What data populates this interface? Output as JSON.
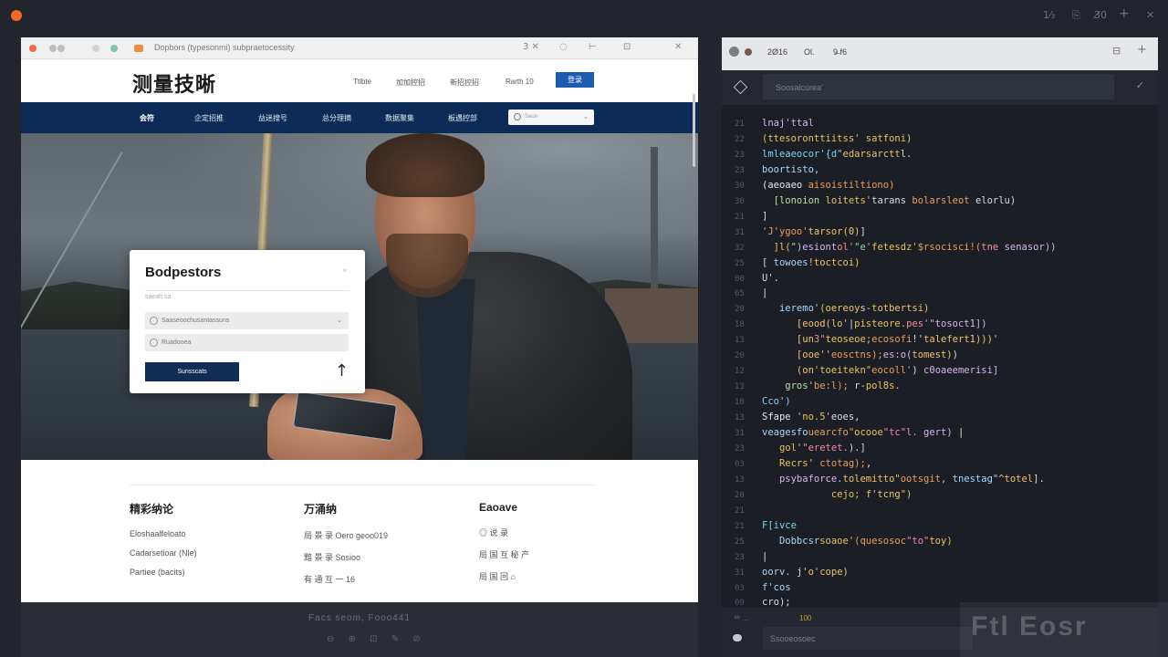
{
  "desktop": {
    "controls": [
      "1⁄₃",
      "⎘",
      "3̸0",
      "+",
      "✕"
    ],
    "dim_glyph": "◦"
  },
  "browser": {
    "tab_title": "Dopbors (typesonmi) subpraetocessity",
    "chrome_icons": [
      "3 ✕",
      "◌",
      "⊢",
      "⊡",
      "✕"
    ],
    "site": {
      "logo": "测量技晰",
      "nav": [
        "Ttlbte",
        "加加控招",
        "新招控招",
        "Rarth 10"
      ],
      "cta": "登录",
      "blue_nav": [
        "会符",
        "企定招推",
        "益迷搜号",
        "总分理摘",
        "数据聚集",
        "板遇控部"
      ],
      "search_placeholder": "Saun",
      "search_chevron": "⌄"
    },
    "login": {
      "title": "Bodpestors",
      "close": "×",
      "subtitle": "saeah sa",
      "field1": "Saaseoochusantassuns",
      "field1_chevron": "⌄",
      "field2": "Ruadooea",
      "button": "Sunsscats",
      "arrow": "↑"
    },
    "footer": {
      "columns": [
        {
          "heading": "精彩纳论",
          "items": [
            "Eloshaalfeloato",
            "Cadarsetioar (Nle)",
            "Partiee  (bacits)"
          ]
        },
        {
          "heading": "万涌纳",
          "items": [
            "局 景 录   Oero  geoo019",
            "黯 景 录   Sosioo",
            "有 通 互   一 16"
          ]
        },
        {
          "heading": "Eaoave",
          "items": [
            "◎ 说 录",
            "局 国 互 秘 产",
            "局 国 回 ⌂"
          ]
        }
      ]
    },
    "taskbar_text": "Facs  seom,  Fooo441",
    "taskbar_icons": [
      "⊖",
      "⊕",
      "⊡",
      "✎",
      "⊘"
    ]
  },
  "editor": {
    "tabs": [
      "2Ø16",
      "Ol.",
      "9̶ f6"
    ],
    "header_icons": [
      "⊟",
      "+"
    ],
    "search_placeholder": "Soosalcu̇rea'",
    "confirm_icon": "✓",
    "lines": [
      {
        "n": "21",
        "segs": [
          {
            "t": "lnaj'ttal",
            "c": "#d8b6f2"
          }
        ]
      },
      {
        "n": "22",
        "segs": [
          {
            "t": "(ttesoronttiitss' ",
            "c": "#e8c45c"
          },
          {
            "t": "satfoni)",
            "c": "#e8c45c"
          }
        ]
      },
      {
        "n": "23",
        "segs": [
          {
            "t": "lmleaeocor'{d\"",
            "c": "#7ed3f7"
          },
          {
            "t": "edarsarctt",
            "c": "#eac071"
          },
          {
            "t": "l.",
            "c": "#ddd"
          }
        ]
      },
      {
        "n": "23",
        "segs": [
          {
            "t": "boortisto,",
            "c": "#a7d8ff"
          }
        ]
      },
      {
        "n": "30",
        "segs": [
          {
            "t": "(aeoaeo ",
            "c": "#e8e8e8"
          },
          {
            "t": "aisoistiltiono)",
            "c": "#ed9f5c"
          }
        ]
      },
      {
        "n": "30",
        "segs": [
          {
            "t": "  [lonoion ",
            "c": "#b6e3a2"
          },
          {
            "t": "loitets'",
            "c": "#e8c45c"
          },
          {
            "t": "tarans ",
            "c": "#ddd"
          },
          {
            "t": "bolarsleot ",
            "c": "#ed9f5c"
          },
          {
            "t": "elorlu)",
            "c": "#ddd"
          }
        ]
      },
      {
        "n": "21",
        "segs": [
          {
            "t": "]",
            "c": "#ddd"
          }
        ]
      },
      {
        "n": "31",
        "segs": [
          {
            "t": "'J'ygoo'",
            "c": "#ed9f5c"
          },
          {
            "t": "tarsor(0)",
            "c": "#f0c36a"
          },
          {
            "t": "]",
            "c": "#ddd"
          }
        ]
      },
      {
        "n": "32",
        "segs": [
          {
            "t": "  ]l(\"",
            "c": "#f0c36a"
          },
          {
            "t": ")esiont",
            "c": "#d8b6f2"
          },
          {
            "t": "ol'",
            "c": "#f58ba0"
          },
          {
            "t": "\"e'",
            "c": "#8fd9a8"
          },
          {
            "t": "fetesdz'",
            "c": "#e8c45c"
          },
          {
            "t": "$rsocisci!(",
            "c": "#ed9f5c"
          },
          {
            "t": "tne ",
            "c": "#f58ba0"
          },
          {
            "t": "senasor))",
            "c": "#d8b6f2"
          }
        ]
      },
      {
        "n": "25",
        "segs": [
          {
            "t": "[ ",
            "c": "#ddd"
          },
          {
            "t": "towoes",
            "c": "#a7d8ff"
          },
          {
            "t": "!toctcoi)",
            "c": "#f0c36a"
          }
        ]
      },
      {
        "n": "00",
        "segs": [
          {
            "t": "U'.",
            "c": "#ddd"
          }
        ]
      },
      {
        "n": "65",
        "segs": [
          {
            "t": "|",
            "c": "#ddd"
          }
        ]
      },
      {
        "n": "20",
        "segs": [
          {
            "t": "   ieremo'",
            "c": "#a7d8ff"
          },
          {
            "t": "(oereoy",
            "c": "#f0c36a"
          },
          {
            "t": "s-",
            "c": "#ddd"
          },
          {
            "t": "totbertsi)",
            "c": "#f0c36a"
          }
        ]
      },
      {
        "n": "18",
        "segs": [
          {
            "t": "      [eood(lo'",
            "c": "#f0c36a"
          },
          {
            "t": "|",
            "c": "#ddd"
          },
          {
            "t": "pisteore.",
            "c": "#e8c45c"
          },
          {
            "t": "pes'",
            "c": "#f58ba0"
          },
          {
            "t": "\"tosoct1])",
            "c": "#d8b6f2"
          }
        ]
      },
      {
        "n": "13",
        "segs": [
          {
            "t": "      [un",
            "c": "#f0c36a"
          },
          {
            "t": "3\"",
            "c": "#f58ba0"
          },
          {
            "t": "teoseoe;",
            "c": "#e8c45c"
          },
          {
            "t": "ecosofi",
            "c": "#ed9f5c"
          },
          {
            "t": "!'",
            "c": "#ddd"
          },
          {
            "t": "talefert1)))'",
            "c": "#f0c36a"
          }
        ]
      },
      {
        "n": "20",
        "segs": [
          {
            "t": "      [ooe''",
            "c": "#f0c36a"
          },
          {
            "t": "eosctns);",
            "c": "#ed9f5c"
          },
          {
            "t": "es:o(",
            "c": "#d8b6f2"
          },
          {
            "t": "tomest)",
            "c": "#f0c36a"
          },
          {
            "t": ")",
            "c": "#ddd"
          }
        ]
      },
      {
        "n": "12",
        "segs": [
          {
            "t": "      (on'",
            "c": "#f0c36a"
          },
          {
            "t": "toeitekn\"",
            "c": "#e8c45c"
          },
          {
            "t": "eocoll'",
            "c": "#ed9f5c"
          },
          {
            "t": ") ",
            "c": "#ddd"
          },
          {
            "t": "c0oaeemerisi]",
            "c": "#d8b6f2"
          }
        ]
      },
      {
        "n": "13",
        "segs": [
          {
            "t": "    gros'",
            "c": "#b6e3a2"
          },
          {
            "t": "be:l);",
            "c": "#ed9f5c"
          },
          {
            "t": " r-",
            "c": "#ddd"
          },
          {
            "t": "pol8s.",
            "c": "#e8c45c"
          }
        ]
      },
      {
        "n": "10",
        "segs": [
          {
            "t": "Cco')",
            "c": "#7ed3f7"
          }
        ]
      },
      {
        "n": "13",
        "segs": [
          {
            "t": "Sfape ",
            "c": "#e8e8e8"
          },
          {
            "t": "'no.5'",
            "c": "#e8c45c"
          },
          {
            "t": "eoes,",
            "c": "#ddd"
          }
        ]
      },
      {
        "n": "31",
        "segs": [
          {
            "t": "veagesfo",
            "c": "#a7d8ff"
          },
          {
            "t": "uearcfo\"",
            "c": "#ed9f5c"
          },
          {
            "t": "ocooe",
            "c": "#e8c45c"
          },
          {
            "t": "\"tc\"l. ",
            "c": "#f58ba0"
          },
          {
            "t": "gert)",
            "c": "#d8b6f2"
          },
          {
            "t": " |",
            "c": "#ddd"
          }
        ]
      },
      {
        "n": "23",
        "segs": [
          {
            "t": "   gol'",
            "c": "#e8c45c"
          },
          {
            "t": "\"eretet.",
            "c": "#f58ba0"
          },
          {
            "t": ").]",
            "c": "#ddd"
          }
        ]
      },
      {
        "n": "03",
        "segs": [
          {
            "t": "   Recrs'",
            "c": "#e8c45c"
          },
          {
            "t": " ",
            "c": "#ddd"
          },
          {
            "t": "ctotag);",
            "c": "#ed9f5c"
          },
          {
            "t": ",",
            "c": "#ddd"
          }
        ]
      },
      {
        "n": "13",
        "segs": [
          {
            "t": "   psybaforce.",
            "c": "#d8b6f2"
          },
          {
            "t": "tolemitto\"",
            "c": "#f0c36a"
          },
          {
            "t": "ootsgit,",
            "c": "#ed9f5c"
          },
          {
            "t": " tnestag\"",
            "c": "#a7d8ff"
          },
          {
            "t": "^totel",
            "c": "#f0c36a"
          },
          {
            "t": "].",
            "c": "#ddd"
          }
        ]
      },
      {
        "n": "20",
        "segs": [
          {
            "t": "            cejo;",
            "c": "#e8c45c"
          },
          {
            "t": " f'tcng\")",
            "c": "#f0c36a"
          }
        ]
      },
      {
        "n": "21",
        "segs": [
          {
            "t": "",
            "c": "#ddd"
          }
        ]
      },
      {
        "n": "21",
        "segs": [
          {
            "t": "F[ivce",
            "c": "#7ed3f7"
          }
        ]
      },
      {
        "n": "25",
        "segs": [
          {
            "t": "   Dobbcsr",
            "c": "#a7d8ff"
          },
          {
            "t": "soaoe'",
            "c": "#e8c45c"
          },
          {
            "t": "(quesosoc",
            "c": "#ed9f5c"
          },
          {
            "t": "\"to\"",
            "c": "#f58ba0"
          },
          {
            "t": "toy)",
            "c": "#f0c36a"
          }
        ]
      },
      {
        "n": "23",
        "segs": [
          {
            "t": "|",
            "c": "#ddd"
          }
        ]
      },
      {
        "n": "31",
        "segs": [
          {
            "t": "oorv. ",
            "c": "#a7d8ff"
          },
          {
            "t": "j'",
            "c": "#ddd"
          },
          {
            "t": "o'cope)",
            "c": "#f0c36a"
          }
        ]
      },
      {
        "n": "03",
        "segs": [
          {
            "t": "f'cos",
            "c": "#a7d8ff"
          }
        ]
      },
      {
        "n": "09",
        "segs": [
          {
            "t": "cro);",
            "c": "#ddd"
          }
        ]
      }
    ],
    "status_left": "ᵇᵇ  ...",
    "status_right": "100",
    "bottom_input": "Ssooeosoec",
    "watermark": "Ftl Eosr"
  }
}
